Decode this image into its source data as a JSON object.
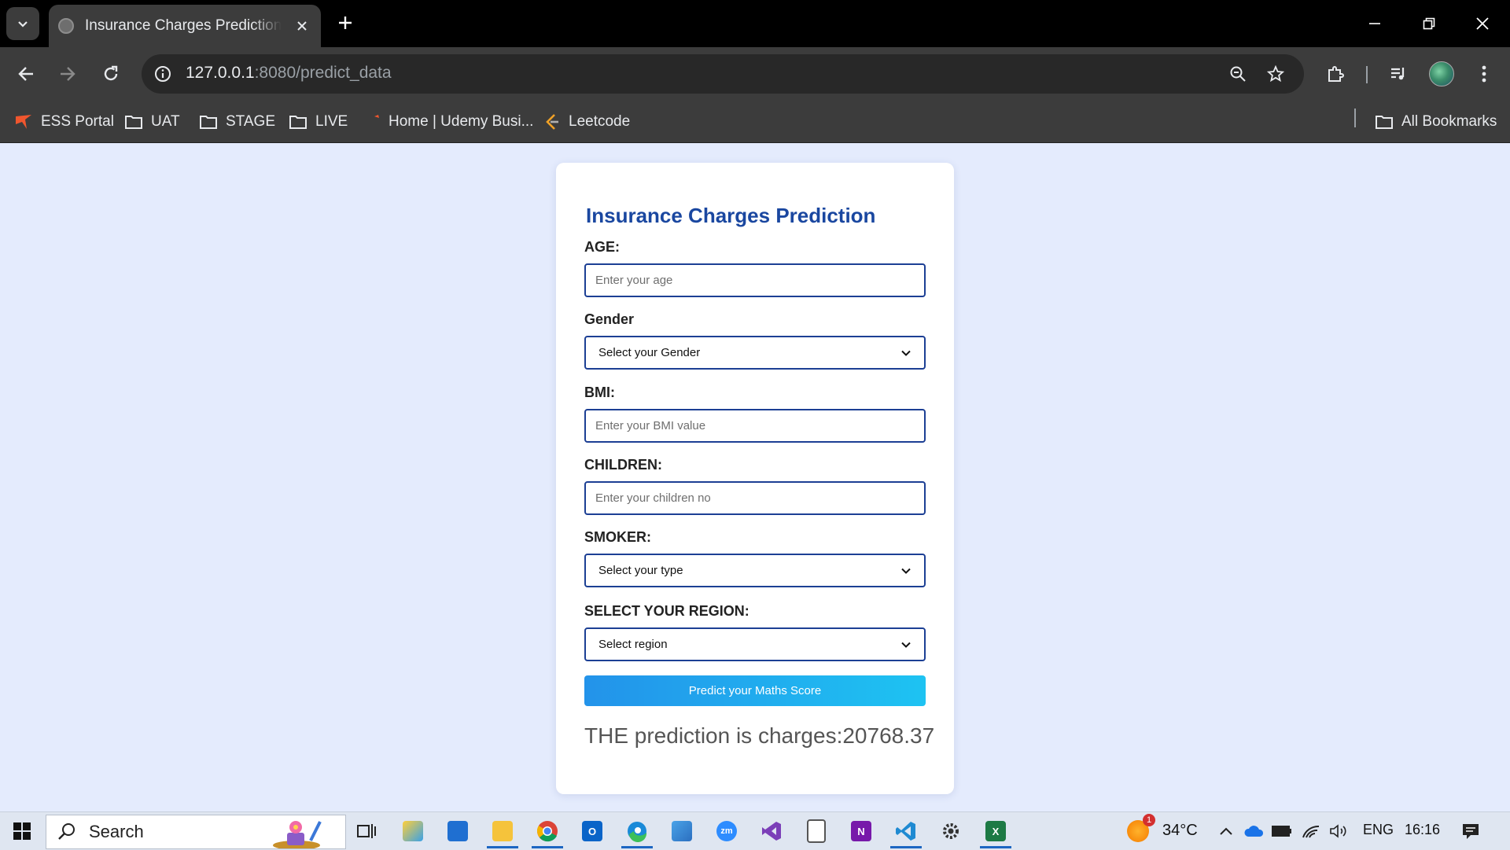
{
  "browser": {
    "tab_title": "Insurance Charges Prediction Form",
    "url_host": "127.0.0.1",
    "url_rest": ":8080/predict_data"
  },
  "bookmarks": {
    "items": [
      {
        "label": "ESS Portal",
        "icon": "ess-portal-icon"
      },
      {
        "label": "UAT",
        "icon": "folder-icon"
      },
      {
        "label": "STAGE",
        "icon": "folder-icon"
      },
      {
        "label": "LIVE",
        "icon": "folder-icon"
      },
      {
        "label": "Home | Udemy Busi...",
        "icon": "udemy-icon"
      },
      {
        "label": "Leetcode",
        "icon": "leetcode-icon"
      }
    ],
    "all_bookmarks": "All Bookmarks"
  },
  "form": {
    "title": "Insurance Charges Prediction",
    "age_label": "AGE:",
    "age_placeholder": "Enter your age",
    "gender_label": "Gender",
    "gender_selected": "Select your Gender",
    "bmi_label": "BMI:",
    "bmi_placeholder": "Enter your BMI value",
    "children_label": "CHILDREN:",
    "children_placeholder": "Enter your children no",
    "smoker_label": "SMOKER:",
    "smoker_selected": "Select your type",
    "region_label": "SELECT YOUR REGION:",
    "region_selected": "Select region",
    "submit_label": "Predict your Maths Score",
    "result": "THE prediction is charges:20768.37"
  },
  "taskbar": {
    "search_text": "Search",
    "weather": "34°C",
    "weather_badge": "1",
    "language": "ENG",
    "time": "16:16"
  },
  "colors": {
    "page_bg": "#e4ebfd",
    "title_blue": "#1a47a0",
    "input_border": "#1c3f94",
    "button_gradient_start": "#2393ea",
    "button_gradient_end": "#1ec3f2"
  }
}
